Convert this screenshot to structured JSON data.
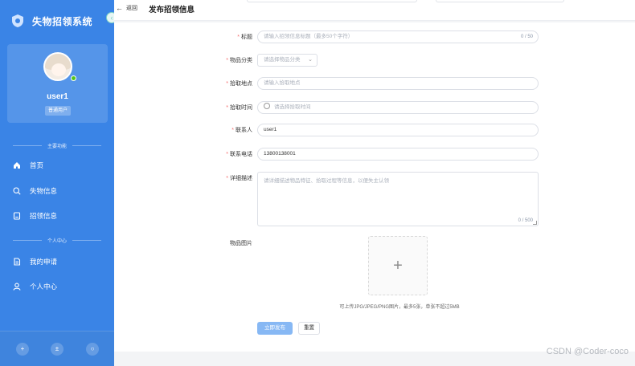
{
  "sidebar": {
    "brand_title": "失物招领系统",
    "collapse_icon": "chevron-left-icon",
    "user": {
      "name": "user1",
      "role": "普通用户",
      "status_color": "#52c41a"
    },
    "section_main": "主要功能",
    "section_personal": "个人中心",
    "items": [
      {
        "label": "首页",
        "icon": "home-icon"
      },
      {
        "label": "失物信息",
        "icon": "search-icon"
      },
      {
        "label": "招领信息",
        "icon": "clipboard-icon"
      },
      {
        "label": "我的申请",
        "icon": "document-icon"
      },
      {
        "label": "个人中心",
        "icon": "user-icon"
      }
    ],
    "footer_buttons": [
      "+",
      "±",
      "○"
    ],
    "accent_color": "#3a84e6"
  },
  "header": {
    "back_label": "返回",
    "page_title": "发布招领信息"
  },
  "form": {
    "title": {
      "label": "标题",
      "placeholder": "请输入招领信息标题（最多50个字符）",
      "counter": "0 / 50"
    },
    "category": {
      "label": "物品分类",
      "placeholder": "请选择物品分类"
    },
    "location": {
      "label": "拾取地点",
      "placeholder": "请输入拾取地点"
    },
    "time": {
      "label": "拾取时间",
      "placeholder": "请选择拾取时间"
    },
    "contact": {
      "label": "联系人",
      "value": "user1"
    },
    "phone": {
      "label": "联系电话",
      "value": "13800138001"
    },
    "description": {
      "label": "详细描述",
      "placeholder": "请详细描述物品特征、拾取过程等信息，以便失主认领",
      "counter": "0 / 500"
    },
    "images": {
      "label": "物品图片",
      "hint": "可上传JPG/JPEG/PNG图片，最多5张，单张不超过5MB"
    },
    "submit_label": "立即发布",
    "reset_label": "重置"
  },
  "watermark": "CSDN @Coder-coco"
}
